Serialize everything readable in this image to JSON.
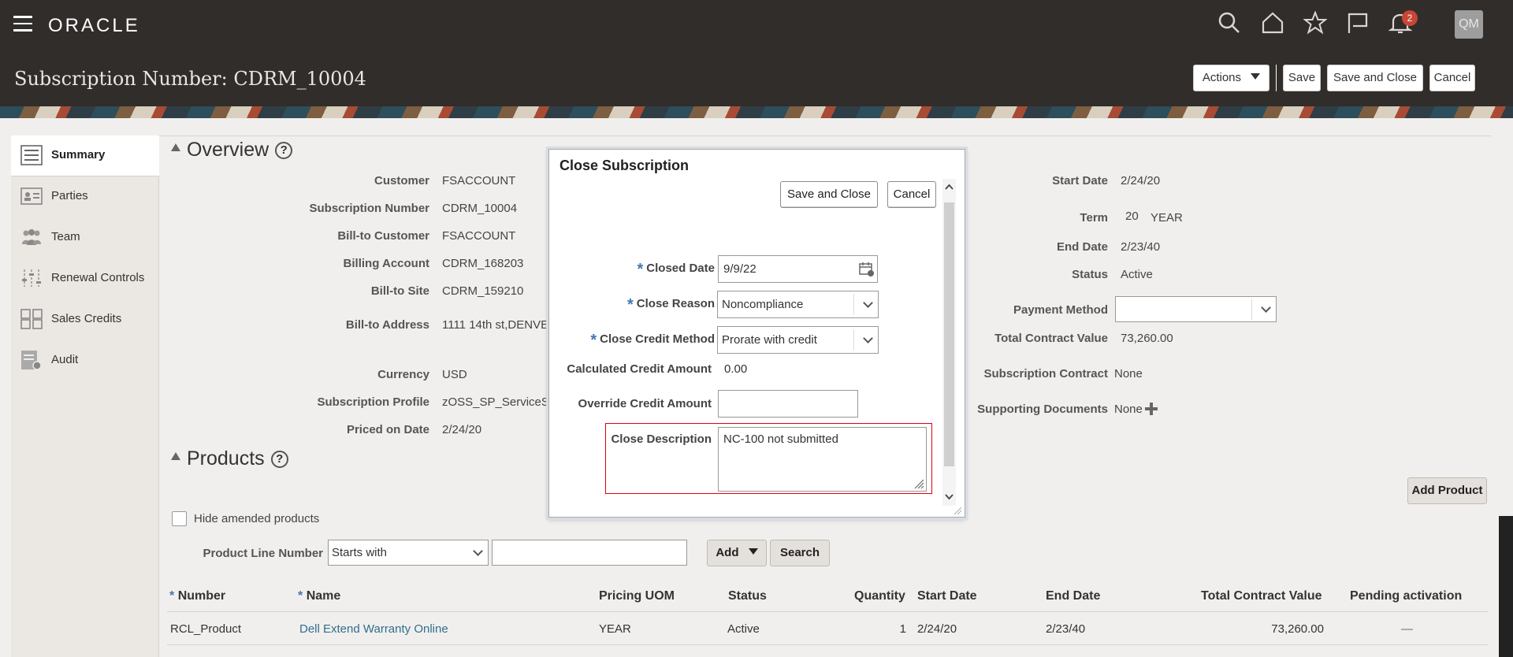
{
  "app": {
    "logo": "ORACLE",
    "avatar": "QM",
    "notification_count": "2"
  },
  "page": {
    "title": "Subscription Number: CDRM_10004"
  },
  "header_buttons": {
    "actions": "Actions",
    "save": "Save",
    "save_close": "Save and Close",
    "cancel": "Cancel"
  },
  "nav": {
    "items": [
      {
        "label": "Summary",
        "icon": "list-icon"
      },
      {
        "label": "Parties",
        "icon": "id-card-icon"
      },
      {
        "label": "Team",
        "icon": "people-icon"
      },
      {
        "label": "Renewal Controls",
        "icon": "sliders-icon"
      },
      {
        "label": "Sales Credits",
        "icon": "grid-icon"
      },
      {
        "label": "Audit",
        "icon": "audit-icon"
      }
    ]
  },
  "overview": {
    "title": "Overview",
    "left": [
      {
        "label": "Customer",
        "value": "FSACCOUNT"
      },
      {
        "label": "Subscription Number",
        "value": "CDRM_10004"
      },
      {
        "label": "Bill-to Customer",
        "value": "FSACCOUNT"
      },
      {
        "label": "Billing Account",
        "value": "CDRM_168203"
      },
      {
        "label": "Bill-to Site",
        "value": "CDRM_159210"
      },
      {
        "label": "Bill-to Address",
        "value": "1111 14th st,DENVE"
      },
      {
        "label": "Currency",
        "value": "USD"
      },
      {
        "label": "Subscription Profile",
        "value": "zOSS_SP_ServiceS"
      },
      {
        "label": "Priced on Date",
        "value": "2/24/20"
      }
    ],
    "right": [
      {
        "label": "Start Date",
        "value": "2/24/20"
      },
      {
        "label": "Term",
        "value": "20",
        "unit": "YEAR"
      },
      {
        "label": "End Date",
        "value": "2/23/40"
      },
      {
        "label": "Status",
        "value": "Active"
      },
      {
        "label": "Payment Method",
        "value": ""
      },
      {
        "label": "Total Contract Value",
        "value": "73,260.00"
      },
      {
        "label": "Subscription Contract",
        "value": "None"
      },
      {
        "label": "Supporting Documents",
        "value": "None"
      }
    ]
  },
  "products": {
    "title": "Products",
    "add_product": "Add Product",
    "hide_amended": "Hide amended products",
    "filter_label": "Product Line Number",
    "filter_operator": "Starts with",
    "add": "Add",
    "search": "Search",
    "columns": [
      "Number",
      "Name",
      "Pricing UOM",
      "Status",
      "Quantity",
      "Start Date",
      "End Date",
      "Total Contract Value",
      "Pending activation"
    ],
    "rows": [
      [
        "RCL_Product",
        "Dell Extend Warranty Online",
        "YEAR",
        "Active",
        "1",
        "2/24/20",
        "2/23/40",
        "73,260.00",
        "—"
      ]
    ]
  },
  "modal": {
    "title": "Close Subscription",
    "save_close": "Save and Close",
    "cancel": "Cancel",
    "closed_date_label": "Closed Date",
    "closed_date": "9/9/22",
    "close_reason_label": "Close Reason",
    "close_reason": "Noncompliance",
    "credit_method_label": "Close Credit Method",
    "credit_method": "Prorate with credit",
    "calc_credit_label": "Calculated Credit Amount",
    "calc_credit": "0.00",
    "override_label": "Override Credit Amount",
    "override_value": "",
    "description_label": "Close Description",
    "description": "NC-100 not submitted",
    "required_marker": "*"
  }
}
